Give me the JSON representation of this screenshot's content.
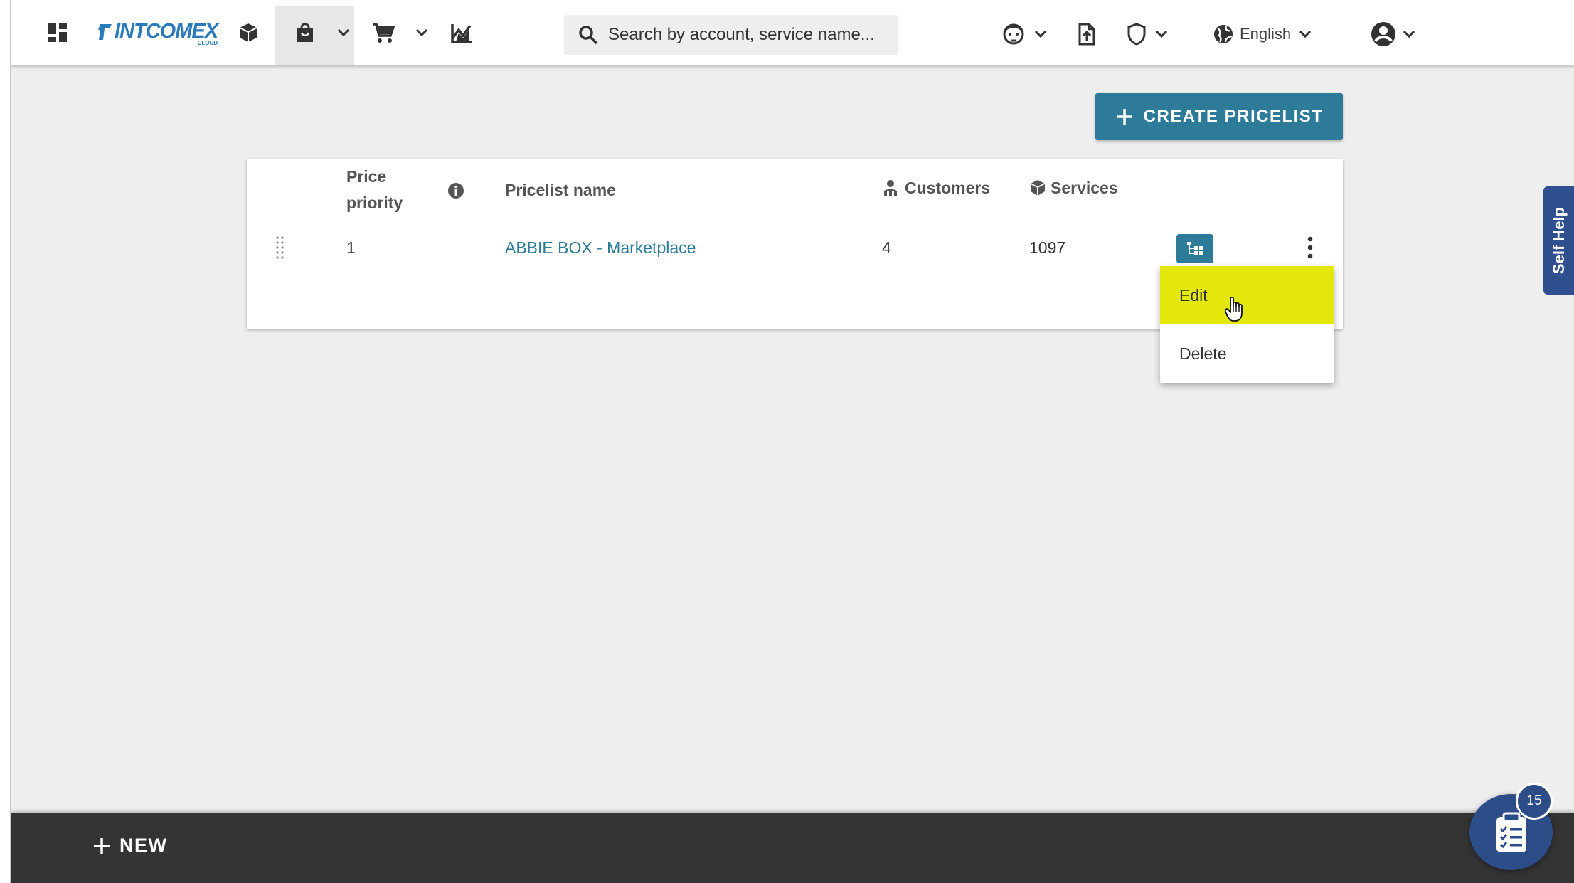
{
  "header": {
    "logo_text": "INTCOMEX",
    "logo_sub": "CLOUD",
    "search_placeholder": "Search by account, service name...",
    "language": "English"
  },
  "toolbar": {
    "create_label": "CREATE PRICELIST"
  },
  "table": {
    "columns": {
      "priority": "Price priority",
      "name": "Pricelist name",
      "customers": "Customers",
      "services": "Services"
    },
    "rows": [
      {
        "priority": "1",
        "name": "ABBIE BOX - Marketplace",
        "customers": "4",
        "services": "1097"
      }
    ]
  },
  "menu": {
    "items": [
      "Edit",
      "Delete"
    ],
    "highlighted": "Edit"
  },
  "self_help": "Self Help",
  "bottom": {
    "new_label": "NEW"
  },
  "fab": {
    "badge": "15"
  },
  "colors": {
    "accent": "#2d7b99",
    "highlight": "#e4e70c",
    "selfhelp": "#2f4f8f",
    "bottombar": "#343434"
  }
}
